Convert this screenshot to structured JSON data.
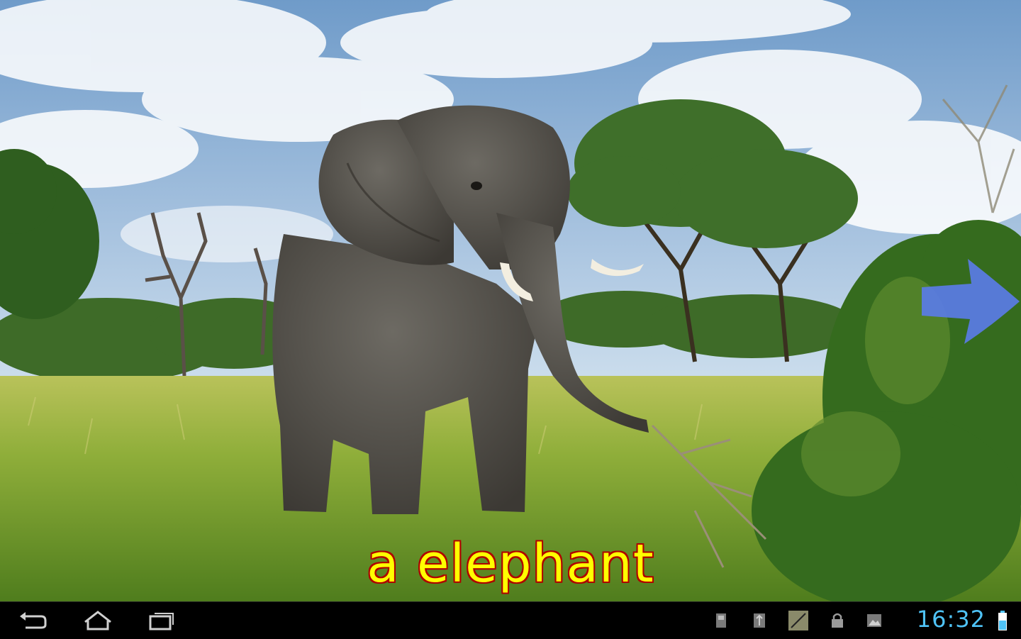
{
  "scene": {
    "subject": "elephant photograph",
    "caption": "a elephant",
    "caption_color": "#ffff00",
    "caption_outline_color": "#b00000",
    "next_arrow_color": "#5a7be0"
  },
  "system_bar": {
    "time": "16:32",
    "clock_color": "#4fc3f7",
    "nav_buttons": [
      "back-icon",
      "home-icon",
      "recent-apps-icon"
    ],
    "status_icons": [
      "sd-card-icon",
      "usb-icon",
      "signal-icon",
      "lock-icon",
      "gallery-icon",
      "battery-icon"
    ]
  }
}
